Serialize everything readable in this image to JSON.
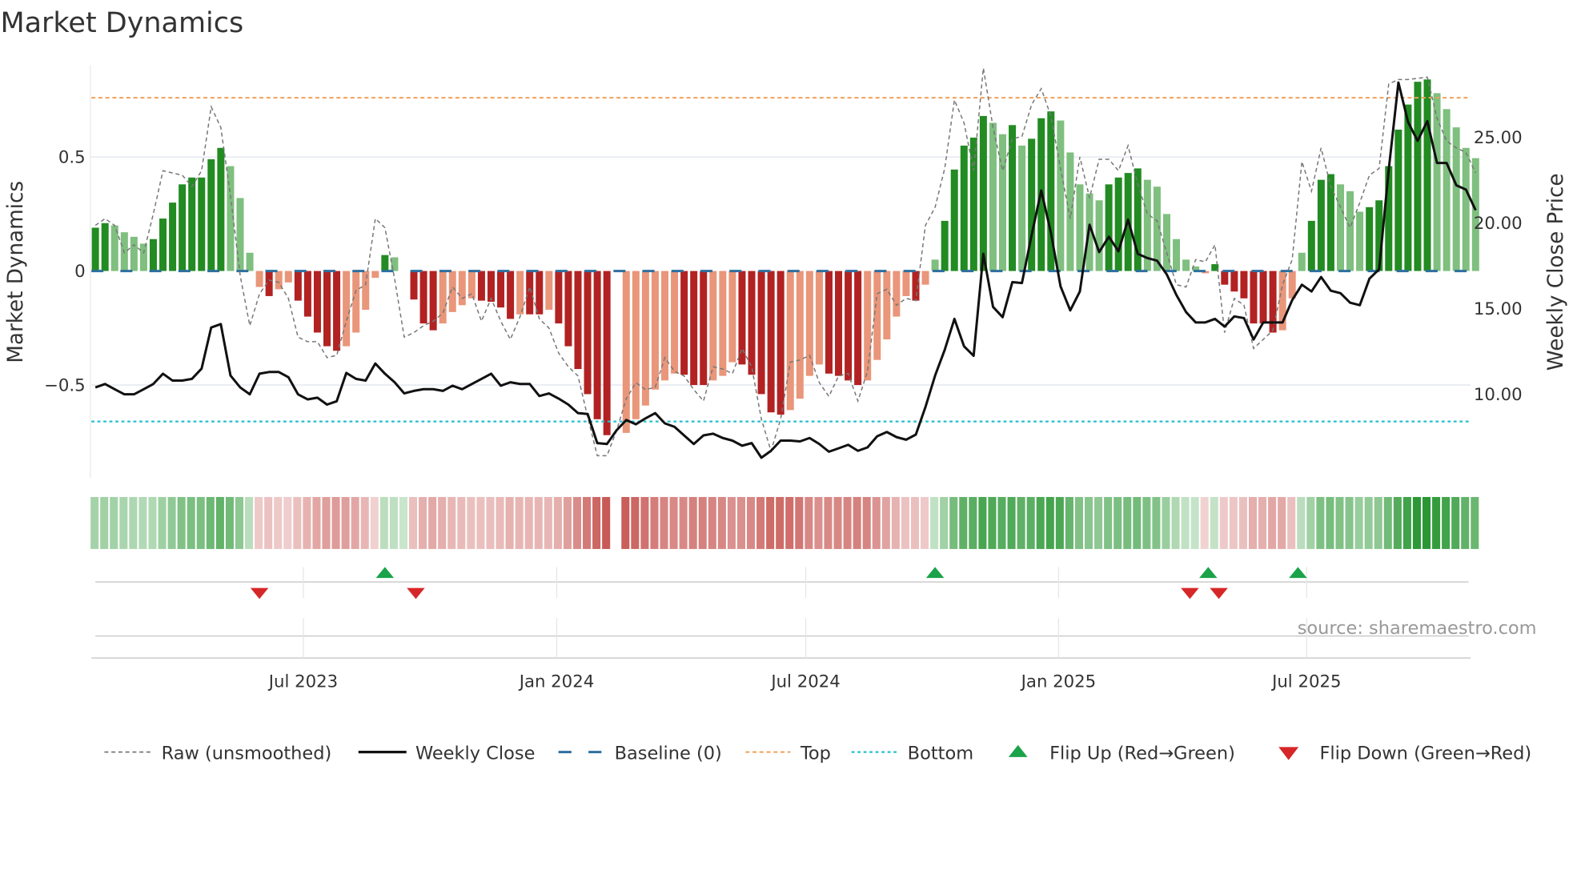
{
  "chart_data": {
    "type": "bar",
    "title": "Market Dynamics",
    "ylabel": "Market Dynamics",
    "y2label": "Weekly Close Price",
    "source": "source: sharemaestro.com",
    "ylim": [
      -0.91,
      0.9
    ],
    "y2lim": [
      5.1,
      29.2
    ],
    "yticks": [
      {
        "v": 0.5,
        "label": "0.5"
      },
      {
        "v": 0,
        "label": "0"
      },
      {
        "v": -0.5,
        "label": "−0.5"
      }
    ],
    "y2ticks": [
      {
        "v": 25,
        "label": "25.00"
      },
      {
        "v": 20,
        "label": "20.00"
      },
      {
        "v": 15,
        "label": "15.00"
      },
      {
        "v": 10,
        "label": "10.00"
      }
    ],
    "xticks": [
      {
        "week": 21.55,
        "label": "Jul 2023"
      },
      {
        "week": 47.8,
        "label": "Jan 2024"
      },
      {
        "week": 73.6,
        "label": "Jul 2024"
      },
      {
        "week": 99.8,
        "label": "Jan 2025"
      },
      {
        "week": 125.5,
        "label": "Jul 2025"
      }
    ],
    "top": 0.76,
    "bottom": -0.66,
    "baseline": 0,
    "values": [
      0.19,
      0.21,
      0.2,
      0.17,
      0.15,
      0.12,
      0.14,
      0.23,
      0.3,
      0.38,
      0.41,
      0.41,
      0.49,
      0.54,
      0.46,
      0.32,
      0.08,
      -0.07,
      -0.11,
      -0.08,
      -0.05,
      -0.13,
      -0.2,
      -0.27,
      -0.33,
      -0.35,
      -0.33,
      -0.27,
      -0.17,
      -0.03,
      0.07,
      0.06,
      0.0,
      -0.125,
      -0.23,
      -0.26,
      -0.23,
      -0.18,
      -0.15,
      -0.12,
      -0.13,
      -0.135,
      -0.16,
      -0.21,
      -0.19,
      -0.19,
      -0.19,
      -0.17,
      -0.23,
      -0.33,
      -0.43,
      -0.54,
      -0.65,
      -0.72,
      null,
      -0.71,
      -0.65,
      -0.59,
      -0.52,
      -0.48,
      -0.45,
      -0.455,
      -0.5,
      -0.5,
      -0.48,
      -0.46,
      -0.4,
      -0.41,
      -0.455,
      -0.54,
      -0.62,
      -0.63,
      -0.61,
      -0.56,
      -0.46,
      -0.41,
      -0.45,
      -0.46,
      -0.48,
      -0.5,
      -0.48,
      -0.39,
      -0.3,
      -0.2,
      -0.11,
      -0.13,
      -0.06,
      0.05,
      0.22,
      0.445,
      0.55,
      0.585,
      0.68,
      0.65,
      0.6,
      0.64,
      0.55,
      0.58,
      0.67,
      0.7,
      0.66,
      0.52,
      0.38,
      0.34,
      0.31,
      0.38,
      0.41,
      0.43,
      0.45,
      0.4,
      0.37,
      0.25,
      0.14,
      0.05,
      0.02,
      -0.01,
      0.03,
      -0.06,
      -0.09,
      -0.12,
      -0.23,
      -0.23,
      -0.27,
      -0.26,
      -0.12,
      0.08,
      0.22,
      0.4,
      0.425,
      0.38,
      0.35,
      0.26,
      0.28,
      0.31,
      0.46,
      0.62,
      0.73,
      0.83,
      0.84,
      0.78,
      0.71,
      0.63,
      0.54,
      0.495
    ],
    "raw": [
      0.2,
      0.23,
      0.2,
      0.08,
      0.115,
      0.08,
      0.25,
      0.44,
      0.43,
      0.42,
      0.37,
      0.44,
      0.72,
      0.63,
      0.33,
      -0.02,
      -0.24,
      -0.1,
      -0.04,
      -0.05,
      -0.12,
      -0.29,
      -0.31,
      -0.31,
      -0.38,
      -0.37,
      -0.22,
      -0.085,
      -0.06,
      0.23,
      0.19,
      -0.035,
      -0.29,
      -0.27,
      -0.24,
      -0.22,
      -0.185,
      -0.07,
      -0.12,
      -0.1,
      -0.22,
      -0.12,
      -0.22,
      -0.3,
      -0.2,
      -0.07,
      -0.21,
      -0.25,
      -0.36,
      -0.42,
      -0.46,
      -0.64,
      -0.81,
      -0.81,
      -0.7,
      -0.56,
      -0.49,
      -0.52,
      -0.51,
      -0.38,
      -0.44,
      -0.46,
      -0.52,
      -0.57,
      -0.42,
      -0.43,
      -0.45,
      -0.34,
      -0.42,
      -0.65,
      -0.79,
      -0.65,
      -0.4,
      -0.39,
      -0.37,
      -0.49,
      -0.55,
      -0.46,
      -0.45,
      -0.57,
      -0.44,
      -0.1,
      -0.08,
      -0.15,
      -0.12,
      -0.13,
      0.2,
      0.28,
      0.45,
      0.75,
      0.65,
      0.44,
      0.89,
      0.63,
      0.44,
      0.58,
      0.59,
      0.73,
      0.8,
      0.68,
      0.45,
      0.23,
      0.5,
      0.32,
      0.49,
      0.49,
      0.44,
      0.55,
      0.38,
      0.25,
      0.22,
      0.08,
      -0.06,
      -0.07,
      0.05,
      0.04,
      0.115,
      -0.27,
      -0.12,
      -0.15,
      -0.34,
      -0.3,
      -0.26,
      -0.06,
      0.05,
      0.48,
      0.35,
      0.54,
      0.37,
      0.28,
      0.19,
      0.3,
      0.42,
      0.45,
      0.82,
      0.84,
      0.84,
      0.845,
      0.85,
      0.67,
      0.57,
      0.54,
      0.52,
      0.43
    ],
    "price": [
      10.4,
      10.6,
      10.3,
      10.0,
      10.0,
      10.3,
      10.6,
      11.2,
      10.8,
      10.8,
      10.9,
      11.5,
      13.9,
      14.1,
      11.1,
      10.4,
      10.0,
      11.2,
      11.3,
      11.3,
      11.0,
      10.0,
      9.7,
      9.8,
      9.4,
      9.6,
      11.25,
      10.9,
      10.8,
      11.8,
      11.2,
      10.7,
      10.05,
      10.2,
      10.3,
      10.3,
      10.2,
      10.5,
      10.3,
      10.6,
      10.9,
      11.2,
      10.5,
      10.7,
      10.6,
      10.6,
      9.9,
      10.05,
      9.75,
      9.4,
      8.9,
      8.85,
      7.15,
      7.1,
      7.9,
      8.5,
      8.25,
      8.6,
      8.9,
      8.3,
      8.1,
      7.6,
      7.1,
      7.6,
      7.7,
      7.45,
      7.3,
      7.0,
      7.15,
      6.3,
      6.7,
      7.3,
      7.3,
      7.25,
      7.45,
      7.1,
      6.65,
      6.85,
      7.05,
      6.7,
      6.9,
      7.55,
      7.8,
      7.5,
      7.35,
      7.65,
      9.25,
      11.1,
      12.6,
      14.4,
      12.8,
      12.25,
      18.2,
      15.1,
      14.5,
      16.55,
      16.5,
      19.3,
      21.9,
      19.45,
      16.3,
      14.9,
      16.0,
      19.9,
      18.3,
      19.2,
      18.35,
      20.2,
      18.2,
      17.95,
      17.8,
      17.0,
      15.8,
      14.8,
      14.2,
      14.2,
      14.4,
      13.95,
      14.55,
      14.45,
      13.2,
      14.2,
      14.2,
      14.2,
      15.5,
      16.4,
      16.0,
      16.85,
      16.05,
      15.9,
      15.35,
      15.2,
      16.75,
      17.3,
      23.1,
      28.2,
      25.9,
      24.8,
      25.95,
      23.5,
      23.5,
      22.2,
      21.95,
      20.75
    ],
    "flip_up_weeks": [
      30,
      87,
      115.3,
      124.6
    ],
    "flip_down_weeks": [
      17,
      33.2,
      113.4,
      116.4
    ],
    "legend": [
      {
        "key": "raw",
        "label": "Raw (unsmoothed)"
      },
      {
        "key": "close",
        "label": "Weekly Close"
      },
      {
        "key": "baseline",
        "label": "Baseline (0)"
      },
      {
        "key": "top",
        "label": "Top"
      },
      {
        "key": "bottom",
        "label": "Bottom"
      },
      {
        "key": "flipup",
        "label": "Flip Up (Red→Green)"
      },
      {
        "key": "flipdown",
        "label": "Flip Down (Green→Red)"
      }
    ],
    "legend_position": "bottom",
    "colors": {
      "green_strong": "#228b22",
      "green_weak": "#7fbf7f",
      "red_strong": "#b22222",
      "red_weak": "#e9967a",
      "raw": "#777777",
      "close": "#111111",
      "baseline": "#2e6f9e",
      "top": "#f0a05a",
      "bottom": "#22bfcf",
      "flip_up": "#1aa34a",
      "flip_down": "#d62728"
    }
  }
}
